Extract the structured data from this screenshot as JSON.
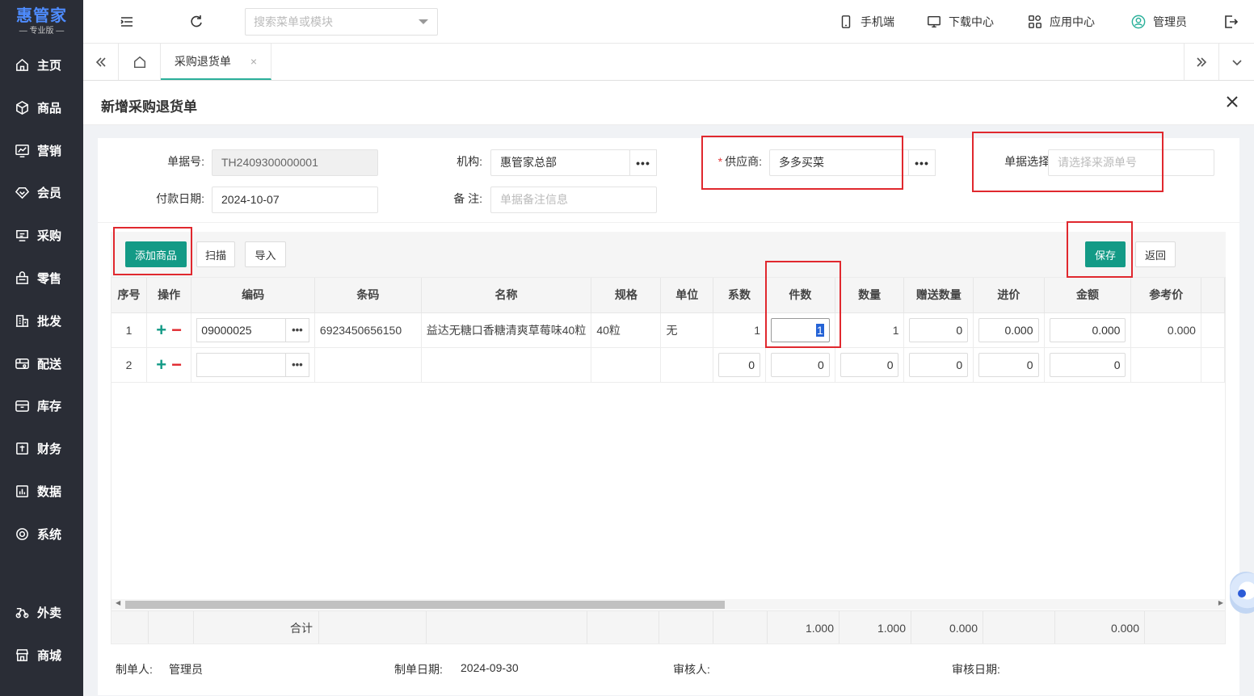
{
  "app": {
    "logo_main": "惠管家",
    "logo_sub": "— 专业版 —"
  },
  "sidebar": {
    "items": [
      {
        "label": "主页",
        "icon": "home-icon"
      },
      {
        "label": "商品",
        "icon": "box-icon"
      },
      {
        "label": "营销",
        "icon": "chart-icon"
      },
      {
        "label": "会员",
        "icon": "diamond-icon"
      },
      {
        "label": "采购",
        "icon": "purchase-icon"
      },
      {
        "label": "零售",
        "icon": "bag-icon"
      },
      {
        "label": "批发",
        "icon": "building-icon"
      },
      {
        "label": "配送",
        "icon": "delivery-icon"
      },
      {
        "label": "库存",
        "icon": "inventory-icon"
      },
      {
        "label": "财务",
        "icon": "finance-icon"
      },
      {
        "label": "数据",
        "icon": "data-icon"
      },
      {
        "label": "系统",
        "icon": "settings-icon"
      },
      {
        "label": "外卖",
        "icon": "scooter-icon"
      },
      {
        "label": "商城",
        "icon": "store-icon"
      }
    ]
  },
  "topbar": {
    "search_placeholder": "搜索菜单或模块",
    "mobile": "手机端",
    "download": "下载中心",
    "apps": "应用中心",
    "user": "管理员"
  },
  "tabs": {
    "active": "采购退货单"
  },
  "page": {
    "title": "新增采购退货单"
  },
  "form": {
    "doc_no_label": "单据号:",
    "doc_no": "TH2409300000001",
    "org_label": "机构:",
    "org": "惠管家总部",
    "supplier_label": "供应商:",
    "supplier": "多多买菜",
    "source_label": "单据选择:",
    "source_placeholder": "请选择来源单号",
    "pay_date_label": "付款日期:",
    "pay_date": "2024-10-07",
    "note_label": "备 注:",
    "note_placeholder": "单据备注信息",
    "dots": "•••"
  },
  "toolbar": {
    "add_goods": "添加商品",
    "scan": "扫描",
    "import": "导入",
    "save": "保存",
    "back": "返回"
  },
  "grid": {
    "headers": [
      "序号",
      "操作",
      "编码",
      "条码",
      "名称",
      "规格",
      "单位",
      "系数",
      "件数",
      "数量",
      "赠送数量",
      "进价",
      "金额",
      "参考价"
    ],
    "rows": [
      {
        "no": "1",
        "code": "09000025",
        "barcode": "6923450656150",
        "name": "益达无糖口香糖清爽草莓味40粒",
        "spec": "40粒",
        "unit": "无",
        "factor": "1",
        "pieces": "1",
        "qty": "1",
        "gift": "0",
        "price": "0.000",
        "amount": "0.000",
        "ref": "0.000"
      },
      {
        "no": "2",
        "code": "",
        "barcode": "",
        "name": "",
        "spec": "",
        "unit": "",
        "factor": "0",
        "pieces": "0",
        "qty": "0",
        "gift": "0",
        "price": "0",
        "amount": "0",
        "ref": ""
      }
    ],
    "sum_label": "合计",
    "sum_pieces": "1.000",
    "sum_qty": "1.000",
    "sum_gift": "0.000",
    "sum_amount": "0.000"
  },
  "footer": {
    "maker_label": "制单人:",
    "maker": "管理员",
    "make_date_label": "制单日期:",
    "make_date": "2024-09-30",
    "auditor_label": "审核人:",
    "audit_date_label": "审核日期:"
  },
  "colors": {
    "primary": "#139a86",
    "sidebar": "#2a2d36",
    "highlight": "#e0282e"
  }
}
